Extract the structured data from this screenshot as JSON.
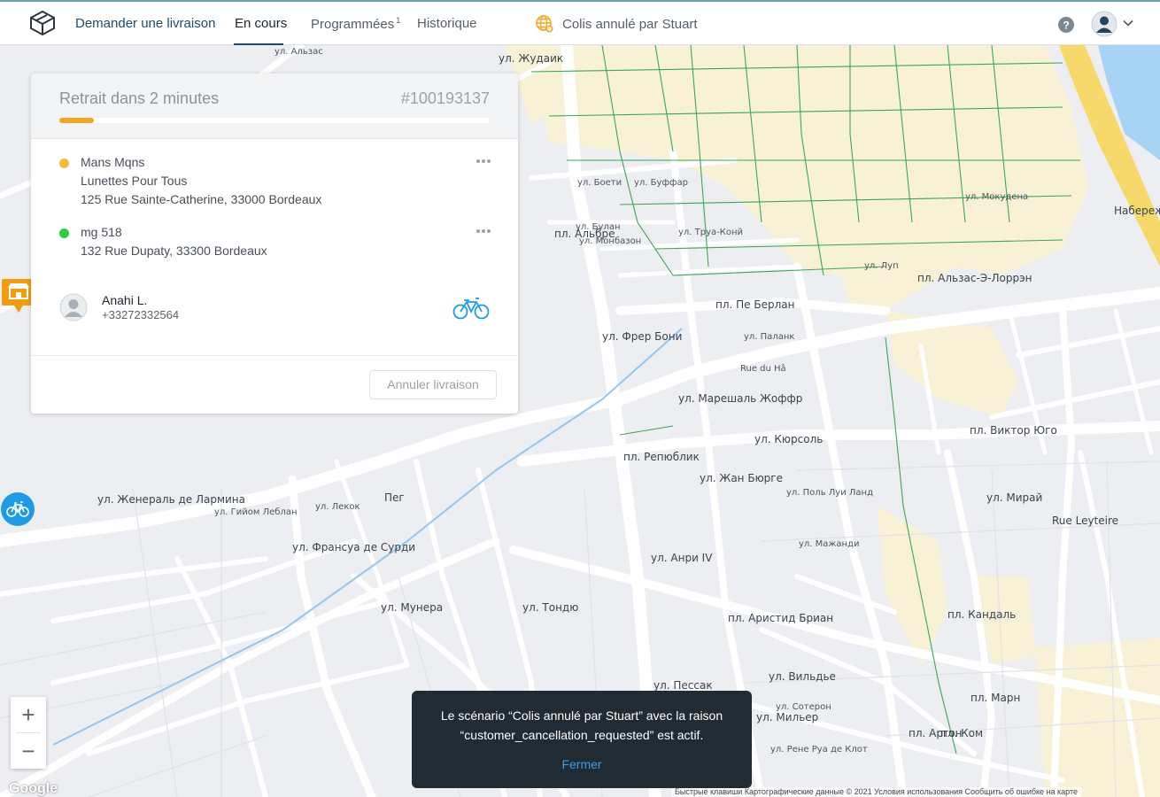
{
  "nav": {
    "items": [
      {
        "label": "Demander une livraison"
      },
      {
        "label": "En cours"
      },
      {
        "label": "Programmées",
        "badge": "1"
      },
      {
        "label": "Historique"
      }
    ],
    "scenario_label": "Colis annulé par Stuart"
  },
  "delivery": {
    "pickup_title": "Retrait dans 2 minutes",
    "order_number": "#100193137",
    "progress_fraction": 0.08,
    "pickup": {
      "name": "Mans Mqns",
      "company": "Lunettes Pour Tous",
      "address": "125 Rue Sainte-Catherine, 33000 Bordeaux",
      "dot_color": "#f5b93d"
    },
    "dropoff": {
      "name": "mg 518",
      "address": "132 Rue Dupaty, 33300 Bordeaux",
      "dot_color": "#2ecc40"
    },
    "courier": {
      "name": "Anahi L.",
      "phone": "+33272332564",
      "vehicle_icon": "bicycle-icon"
    },
    "cancel_label": "Annuler livraison"
  },
  "map": {
    "labels": [
      "ул. Жудаик",
      "ул. Альзас",
      "ул. Боети",
      "ул. Буффар",
      "ул. Булан",
      "ул. Монбазон",
      "ул. Труа-Конй",
      "пл. Альбре",
      "ул. Мокудена",
      "ул. Луп",
      "пл. Альзас-Э-Лоррэн",
      "пл. Пе Берлан",
      "ул. Фрер Бони",
      "Rue du Hâ",
      "ул. Паланк",
      "ул. Марешаль Жоффр",
      "пл. Виктор Юго",
      "ул. Кюрсоль",
      "пл. Репюблик",
      "ул. Жан Бюрге",
      "ул. Поль Луи Ланд",
      "ул. Мажанди",
      "ул. Анри IV",
      "пл. Аристид Бриан",
      "ул. Женераль де Лармина",
      "ул. Гийом Леблан",
      "ул. Лекок",
      "ул. Франсуа де Сурди",
      "Пег",
      "ул. Мунера",
      "ул. Тондю",
      "ул. Пессак",
      "ул. Вильдье",
      "ул. Мирай",
      "пл. Марн",
      "Rue Leyteire",
      "пл. Кандаль",
      "пл. Аргон",
      "пл. Ком",
      "ул. Мильер",
      "Набережная",
      "ул. Сотерон",
      "ул. Рене Руа де Клот"
    ],
    "attribution": "Быстрые клавиши   Картографические данные © 2021   Условия использования   Сообщить об ошибке на карте",
    "google": "Google"
  },
  "toast": {
    "message": "Le scénario “Colis annulé par Stuart” avec la raison “customer_cancellation_requested” est actif.",
    "close_label": "Fermer"
  },
  "colors": {
    "accent": "#1d4a6b",
    "progress": "#f5a623",
    "store_pin": "#f39c12",
    "courier_pin": "#1e9be4",
    "toast_bg": "#212b33"
  }
}
